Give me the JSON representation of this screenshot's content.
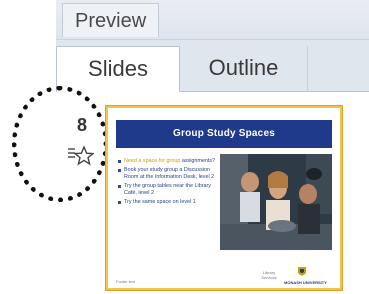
{
  "preview_tab": {
    "label": "Preview"
  },
  "pane_tabs": [
    {
      "label": "Slides",
      "active": true
    },
    {
      "label": "Outline",
      "active": false
    }
  ],
  "slide": {
    "number": "8",
    "icon": "star-icon",
    "title": "Group Study Spaces",
    "bullets": [
      {
        "q": "Need a space for group",
        "b": "assignments?"
      },
      {
        "q": "",
        "b": "Book your study group a Discussion Room at the Information Desk, level 2"
      },
      {
        "q": "",
        "b": "Try the group tables near the Library Café, level 2"
      },
      {
        "q": "",
        "b": "Try the same space on level 1"
      }
    ],
    "footer_left": "Footer text",
    "footer_mid": "Library Services",
    "footer_right": "MONASH UNIVERSITY"
  },
  "colors": {
    "title_bar": "#1f3a8a",
    "bullet_text": "#2a3f8f",
    "question_text": "#c9a300",
    "thumbnail_selected_border": "#f2c24a"
  }
}
